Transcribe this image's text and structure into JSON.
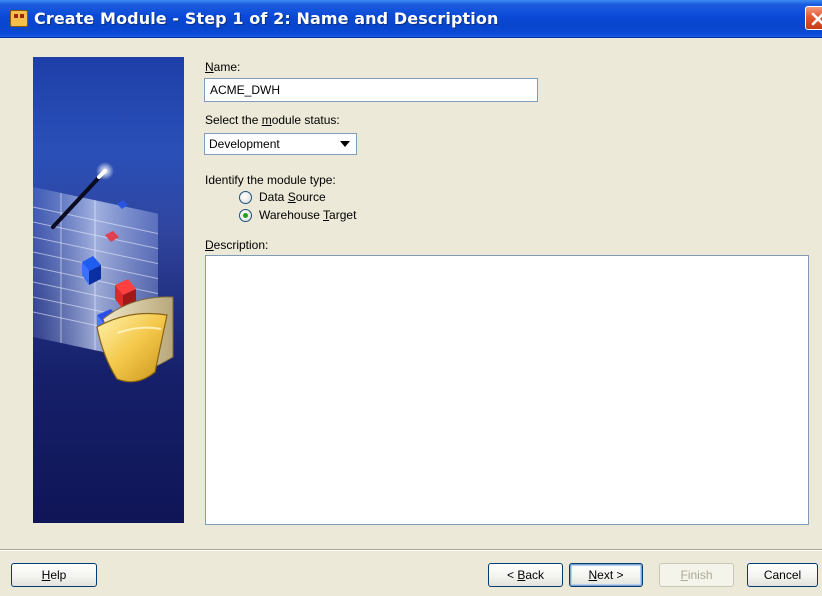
{
  "window": {
    "title": "Create Module - Step 1 of 2: Name and Description"
  },
  "form": {
    "name": {
      "label_prefix": "",
      "label_mnemonic": "N",
      "label_rest": "ame:",
      "value": "ACME_DWH"
    },
    "status": {
      "label_prefix": "Select the ",
      "label_mnemonic": "m",
      "label_rest": "odule status:",
      "value": "Development"
    },
    "module_type": {
      "label": "Identify the module type:",
      "options": [
        {
          "prefix": "Data ",
          "mnemonic": "S",
          "rest": "ource",
          "checked": false
        },
        {
          "prefix": "Warehouse ",
          "mnemonic": "T",
          "rest": "arget",
          "checked": true
        }
      ]
    },
    "description": {
      "label_prefix": "",
      "label_mnemonic": "D",
      "label_rest": "escription:",
      "value": ""
    }
  },
  "buttons": {
    "help": {
      "mnemonic": "H",
      "rest": "elp"
    },
    "back": {
      "prefix": "< ",
      "mnemonic": "B",
      "rest": "ack"
    },
    "next": {
      "mnemonic": "N",
      "rest": "ext >"
    },
    "finish": {
      "mnemonic": "F",
      "rest": "inish",
      "enabled": false
    },
    "cancel": {
      "label": "Cancel"
    }
  },
  "colors": {
    "titlebar": "#0a49d6",
    "dialog_bg": "#ece9d8",
    "radio_checked": "#21a121"
  }
}
